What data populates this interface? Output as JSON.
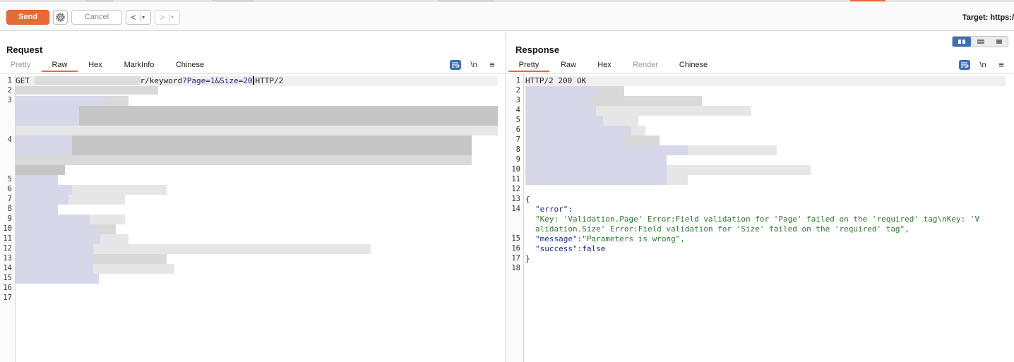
{
  "toolbar": {
    "send_label": "Send",
    "cancel_label": "Cancel",
    "back_arrow": "<",
    "forward_arrow": ">",
    "dropdown_glyph": "▾",
    "target_label": "Target: https:/"
  },
  "request": {
    "title": "Request",
    "tabs": [
      {
        "label": "Pretty",
        "state": "muted"
      },
      {
        "label": "Raw",
        "state": "active"
      },
      {
        "label": "Hex",
        "state": "normal"
      },
      {
        "label": "MarkInfo",
        "state": "normal"
      },
      {
        "label": "Chinese",
        "state": "normal"
      }
    ],
    "newline_toggle": "\\n",
    "menu_glyph": "≡",
    "line_numbers": [
      "1",
      "2",
      "3",
      "4",
      "5",
      "6",
      "7",
      "8",
      "9",
      "10",
      "11",
      "12",
      "13",
      "14",
      "15",
      "16",
      "17"
    ],
    "line1": {
      "method": "GET",
      "path_tail": "r/keyword?",
      "param1_key": "Page",
      "param1_eq": "=",
      "param1_val": "1",
      "amp": "&",
      "param2_key": "Size",
      "param2_eq": "=",
      "param2_val": "20",
      "protocol": "HTTP/2"
    }
  },
  "response": {
    "title": "Response",
    "tabs": [
      {
        "label": "Pretty",
        "state": "active"
      },
      {
        "label": "Raw",
        "state": "normal"
      },
      {
        "label": "Hex",
        "state": "normal"
      },
      {
        "label": "Render",
        "state": "muted"
      },
      {
        "label": "Chinese",
        "state": "normal"
      }
    ],
    "newline_toggle": "\\n",
    "menu_glyph": "≡",
    "line_numbers": [
      "1",
      "2",
      "3",
      "4",
      "5",
      "6",
      "7",
      "8",
      "9",
      "10",
      "11",
      "12",
      "13",
      "14",
      "15",
      "16",
      "17",
      "18"
    ],
    "status_line": "HTTP/2 200 OK",
    "body": {
      "open_brace": "{",
      "error_key": "\"error\":",
      "error_value_1": "\"Key: 'Validation.Page' Error:Field validation for 'Page' failed on the 'required' tag\\nKey: 'V",
      "error_value_2": "alidation.Size' Error:Field validation for 'Size' failed on the 'required' tag\",",
      "message_key": "\"message\":",
      "message_value": "\"Parameters is wrong\",",
      "success_key": "\"success\":",
      "success_value": "false",
      "close_brace": "}"
    }
  },
  "colors": {
    "accent": "#ea6a35",
    "selected_blue": "#3d6fb6",
    "json_string": "#2b7a2b",
    "json_key": "#1e2a9a"
  },
  "icons": {
    "settings": "gear-icon",
    "wrap": "wrap-lines-icon",
    "menu": "hamburger-icon",
    "layout_split": "layout-split-icon",
    "layout_horizontal": "layout-horizontal-icon",
    "layout_single": "layout-single-icon"
  }
}
